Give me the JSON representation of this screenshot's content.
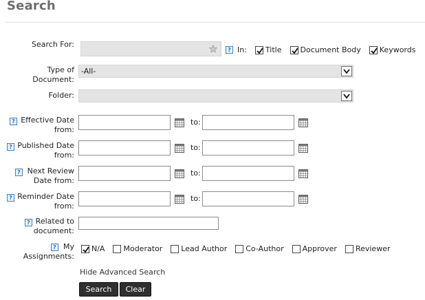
{
  "page": {
    "title": "Search"
  },
  "search_for": {
    "label": "Search For:",
    "in_label": "In:",
    "options": [
      {
        "label": "Title",
        "checked": true
      },
      {
        "label": "Document Body",
        "checked": true
      },
      {
        "label": "Keywords",
        "checked": true
      }
    ]
  },
  "doc_type": {
    "label_line1": "Type of",
    "label_line2": "Document:",
    "value": "-All-"
  },
  "folder": {
    "label": "Folder:",
    "value": ""
  },
  "date_rows": [
    {
      "label_line1": "Effective Date",
      "label_line2": "from:",
      "to_label": "to:"
    },
    {
      "label_line1": "Published Date",
      "label_line2": "from:",
      "to_label": "to:"
    },
    {
      "label_line1": "Next Review",
      "label_line2": "Date from:",
      "to_label": "to:"
    },
    {
      "label_line1": "Reminder Date",
      "label_line2": "from:",
      "to_label": "to:"
    }
  ],
  "related": {
    "label_line1": "Related to",
    "label_line2": "document:",
    "value": ""
  },
  "assignments": {
    "label_line1": "My",
    "label_line2": "Assignments:",
    "options": [
      {
        "label": "N/A",
        "checked": true
      },
      {
        "label": "Moderator",
        "checked": false
      },
      {
        "label": "Lead Author",
        "checked": false
      },
      {
        "label": "Co-Author",
        "checked": false
      },
      {
        "label": "Approver",
        "checked": false
      },
      {
        "label": "Reviewer",
        "checked": false
      }
    ]
  },
  "advanced_link": "Hide Advanced Search",
  "buttons": {
    "search": "Search",
    "clear": "Clear"
  },
  "icons": {
    "help": "?",
    "help_icon": "help-icon",
    "calendar_icon": "calendar-icon",
    "star_icon": "star-icon",
    "dropdown_icon": "chevron-down-icon"
  },
  "colors": {
    "accent": "#3b7fc4",
    "button": "#2f2f2f",
    "field_gray": "#e4e4e4"
  }
}
